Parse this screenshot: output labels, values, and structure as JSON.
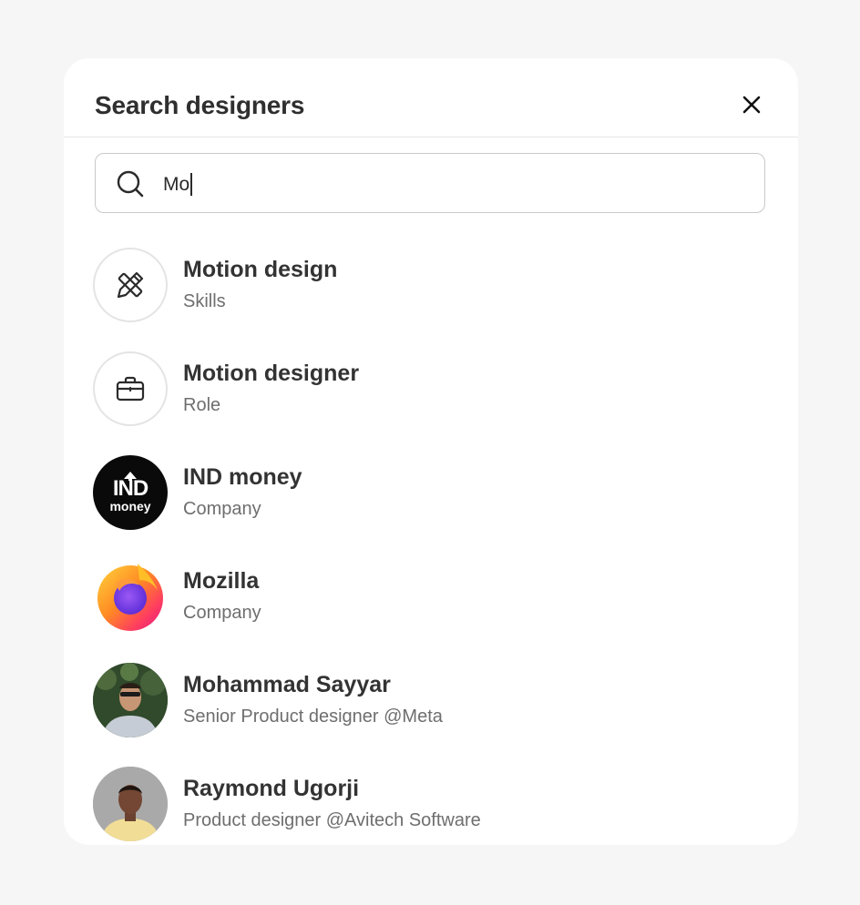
{
  "modal": {
    "title": "Search designers"
  },
  "search": {
    "value": "Mo"
  },
  "results": [
    {
      "title": "Motion design",
      "subtitle": "Skills",
      "icon": "pencil-ruler-icon"
    },
    {
      "title": "Motion designer",
      "subtitle": "Role",
      "icon": "briefcase-icon"
    },
    {
      "title": "IND money",
      "subtitle": "Company",
      "logo_text_top": "IND",
      "logo_text_bottom": "money"
    },
    {
      "title": "Mozilla",
      "subtitle": "Company",
      "icon": "firefox-logo"
    },
    {
      "title": "Mohammad Sayyar",
      "subtitle": "Senior Product designer @Meta",
      "icon": "avatar-photo"
    },
    {
      "title": "Raymond Ugorji",
      "subtitle": "Product designer @Avitech Software",
      "icon": "avatar-photo"
    }
  ],
  "colors": {
    "background": "#f6f6f6",
    "surface": "#ffffff",
    "title": "#333333",
    "subtitle": "#6e6e6e",
    "border": "#c9c9c9"
  }
}
